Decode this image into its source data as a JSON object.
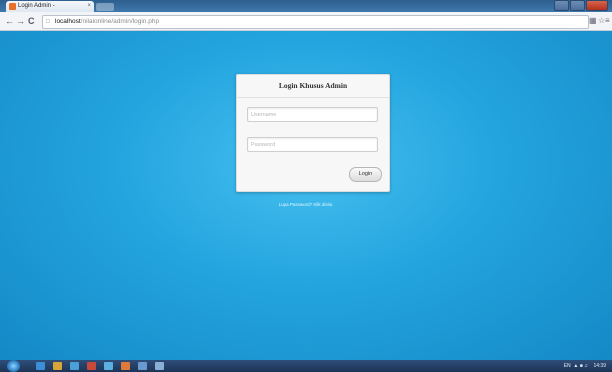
{
  "browser": {
    "tab_title": "Login Admin -",
    "tab_close": "×",
    "url_host": "localhost",
    "url_path": "/nilaionline/admin/login.php",
    "back_icon": "arrow-left-icon",
    "forward_icon": "arrow-right-icon",
    "reload_icon": "reload-icon"
  },
  "login": {
    "title": "Login Khusus Admin",
    "username_placeholder": "Username",
    "password_placeholder": "Password",
    "submit_label": "Login",
    "forgot_text": "Lupa Password? Klik disini."
  },
  "taskbar": {
    "lang": "EN",
    "clock": "14:39"
  },
  "colors": {
    "page_background": "#1e9cd8",
    "card": "#f7f7f7",
    "taskbar": "#1d3456"
  }
}
